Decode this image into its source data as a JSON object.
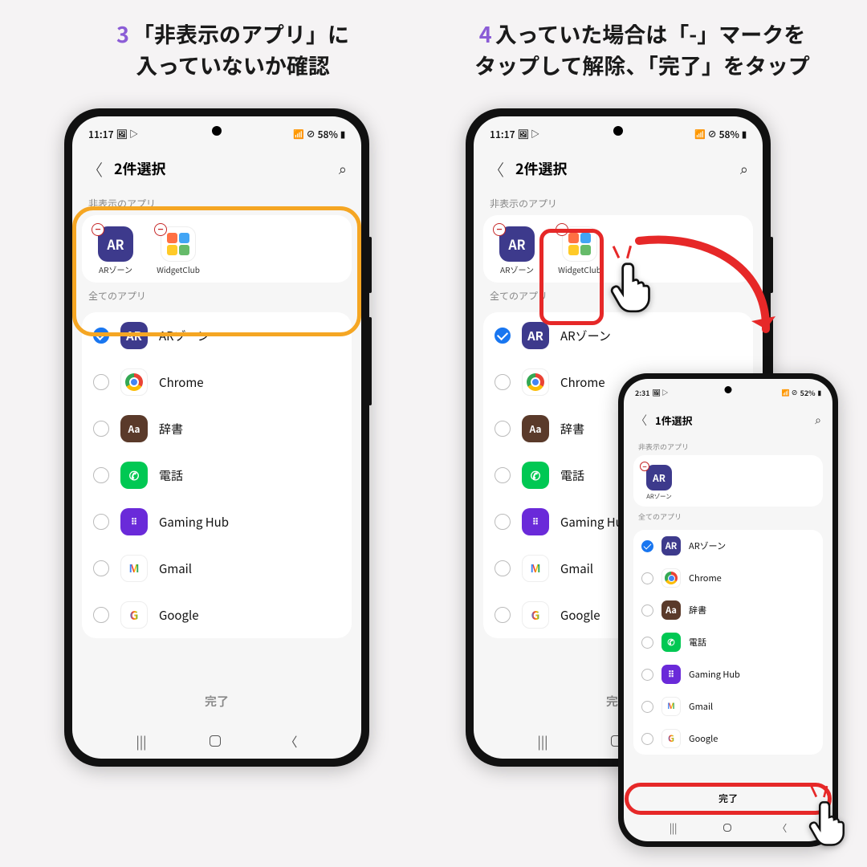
{
  "captions": {
    "step3_num": "3",
    "step3_text": "「非表示のアプリ」に\n入っていないか確認",
    "step4_num": "4",
    "step4_text": "入っていた場合は「-」マークを\nタップして解除、「完了」をタップ"
  },
  "phone_a": {
    "status_time": "11:17",
    "status_battery": "58%",
    "header_title": "2件選択",
    "hidden_section": "非表示のアプリ",
    "all_section": "全てのアプリ",
    "hidden_apps": [
      {
        "name": "ARゾーン",
        "icon": "ar"
      },
      {
        "name": "WidgetClub",
        "icon": "wc"
      }
    ],
    "all_apps": [
      {
        "name": "ARゾーン",
        "icon": "ar",
        "checked": true
      },
      {
        "name": "Chrome",
        "icon": "chrome",
        "checked": false
      },
      {
        "name": "辞書",
        "icon": "dict",
        "checked": false
      },
      {
        "name": "電話",
        "icon": "phone",
        "checked": false
      },
      {
        "name": "Gaming Hub",
        "icon": "gaming",
        "checked": false
      },
      {
        "name": "Gmail",
        "icon": "gmail",
        "checked": false
      },
      {
        "name": "Google",
        "icon": "google",
        "checked": false
      }
    ],
    "done": "完了"
  },
  "phone_b": {
    "status_time": "11:17",
    "status_battery": "58%",
    "header_title": "2件選択",
    "hidden_section": "非表示のアプリ",
    "all_section": "全てのアプリ",
    "hidden_apps": [
      {
        "name": "ARゾーン",
        "icon": "ar"
      },
      {
        "name": "WidgetClub",
        "icon": "wc"
      }
    ],
    "all_apps": [
      {
        "name": "ARゾーン",
        "icon": "ar",
        "checked": true
      },
      {
        "name": "Chrome",
        "icon": "chrome",
        "checked": false
      },
      {
        "name": "辞書",
        "icon": "dict",
        "checked": false
      },
      {
        "name": "電話",
        "icon": "phone",
        "checked": false
      },
      {
        "name": "Gaming Hub",
        "icon": "gaming",
        "checked": false
      },
      {
        "name": "Gmail",
        "icon": "gmail",
        "checked": false
      },
      {
        "name": "Google",
        "icon": "google",
        "checked": false
      }
    ],
    "done": "完了"
  },
  "phone_c": {
    "status_time": "2:31",
    "status_battery": "52%",
    "header_title": "1件選択",
    "hidden_section": "非表示のアプリ",
    "all_section": "全てのアプリ",
    "hidden_apps": [
      {
        "name": "ARゾーン",
        "icon": "ar"
      }
    ],
    "all_apps": [
      {
        "name": "ARゾーン",
        "icon": "ar",
        "checked": true
      },
      {
        "name": "Chrome",
        "icon": "chrome",
        "checked": false
      },
      {
        "name": "辞書",
        "icon": "dict",
        "checked": false
      },
      {
        "name": "電話",
        "icon": "phone",
        "checked": false
      },
      {
        "name": "Gaming Hub",
        "icon": "gaming",
        "checked": false
      },
      {
        "name": "Gmail",
        "icon": "gmail",
        "checked": false
      },
      {
        "name": "Google",
        "icon": "google",
        "checked": false
      }
    ],
    "done": "完了"
  },
  "icon_glyphs": {
    "ar": "AR",
    "dict": "Aa",
    "phone": "✆",
    "gaming": "⠿",
    "gmail": "M",
    "google": "G"
  }
}
